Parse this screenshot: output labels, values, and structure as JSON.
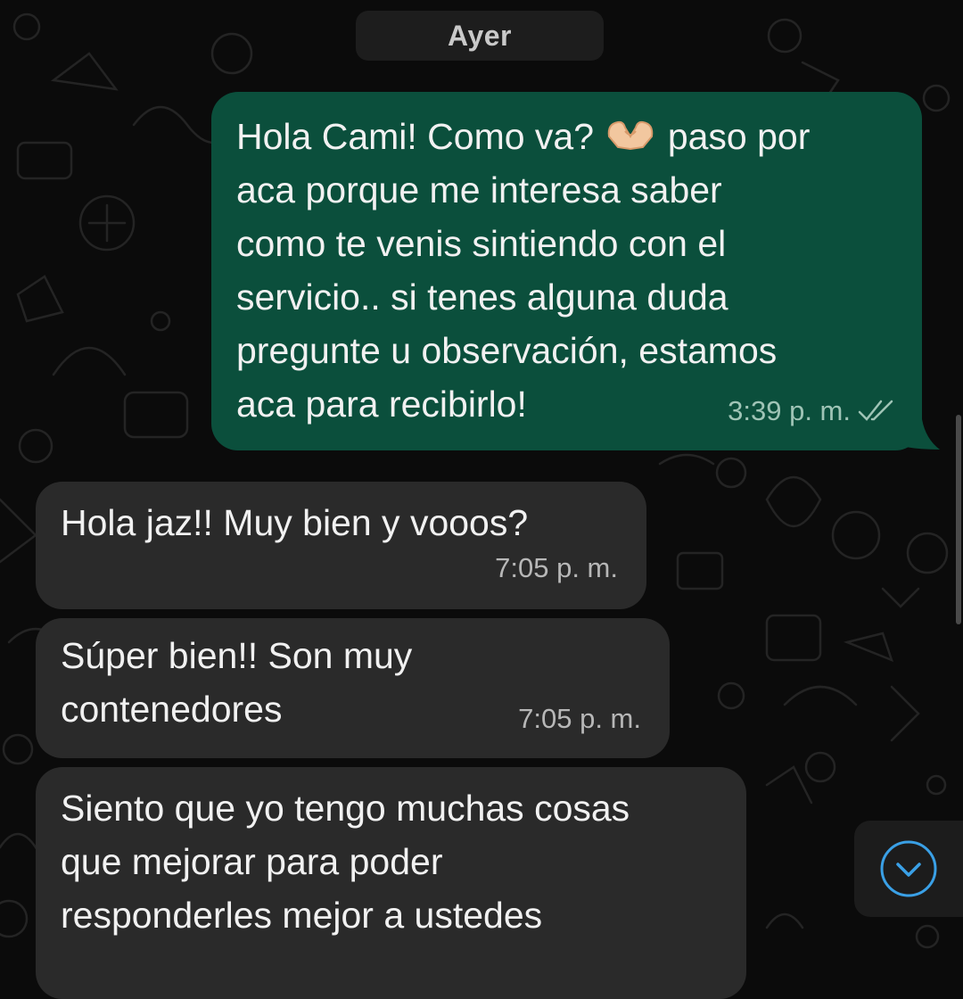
{
  "date_separator": "Ayer",
  "messages": [
    {
      "direction": "outgoing",
      "text_before_emoji": "Hola Cami! Como va? ",
      "emoji": "hands-heart-emoji",
      "text_after_emoji": " paso por\naca porque me interesa saber\ncomo te venis sintiendo con el\nservicio.. si tenes alguna duda\npregunte u observación, estamos\naca para recibirlo!",
      "time": "3:39 p. m.",
      "status": "read-double-check"
    },
    {
      "direction": "incoming",
      "text": "Hola jaz!! Muy bien y vooos?",
      "time": "7:05 p. m."
    },
    {
      "direction": "incoming",
      "text": "Súper bien!! Son muy\ncontenedores",
      "time": "7:05 p. m."
    },
    {
      "direction": "incoming",
      "text": "Siento que yo tengo muchas cosas\nque mejorar para poder\nresponderles mejor a ustedes"
    }
  ],
  "scroll_button_icon": "chevron-down-icon",
  "colors": {
    "outgoing_bubble": "#0b4f3c",
    "incoming_bubble": "#2a2a2a",
    "background": "#0b0b0b",
    "accent": "#3aa0e6"
  }
}
